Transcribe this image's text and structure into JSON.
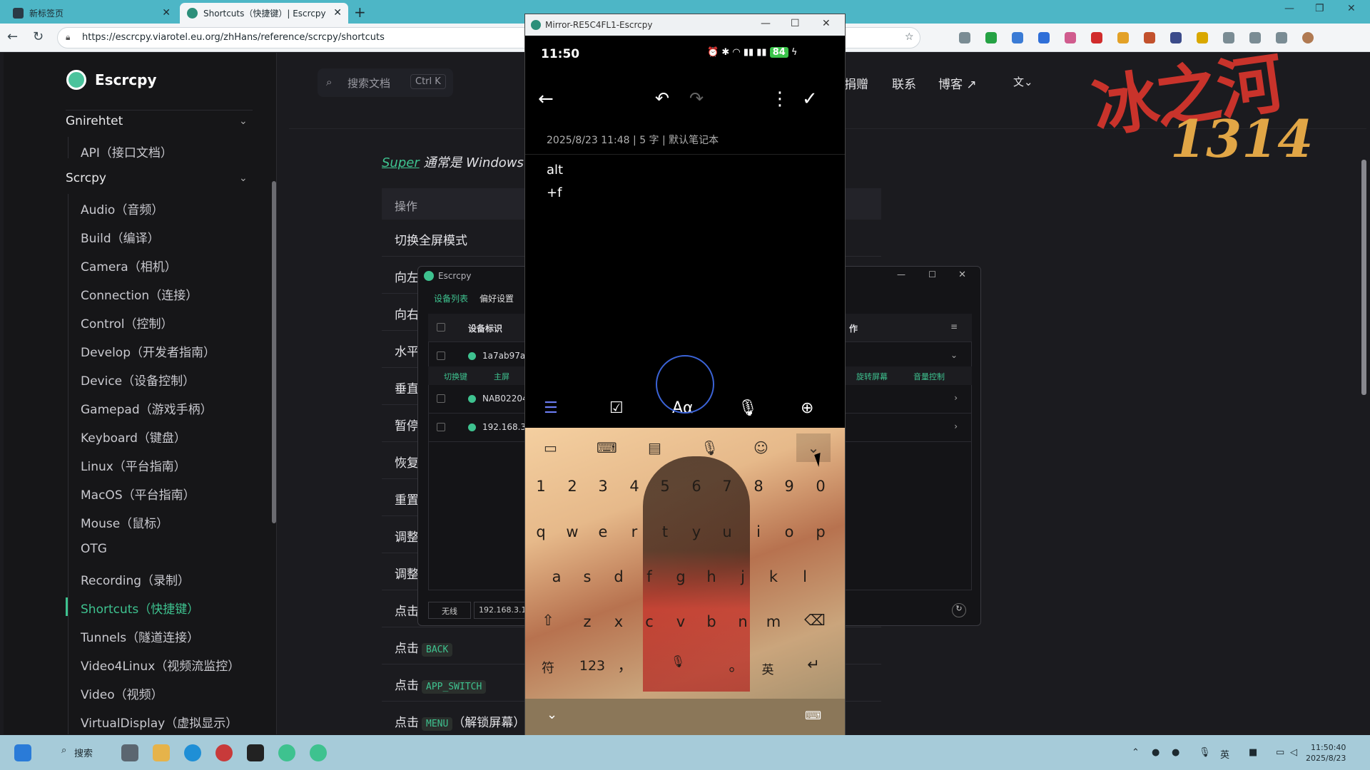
{
  "browser": {
    "tabs": [
      {
        "title": "新标签页"
      },
      {
        "title": "Shortcuts（快捷键）| Escrcpy"
      }
    ],
    "url": "https://escrcpy.viarotel.eu.org/zhHans/reference/scrcpy/shortcuts"
  },
  "site": {
    "brand": "Escrcpy",
    "search_placeholder": "搜索文档",
    "search_shortcut": "Ctrl K",
    "nav": [
      "捐赠",
      "联系",
      "博客 ↗"
    ],
    "sidebar": {
      "section1": "Gnirehtet",
      "section1_items": [
        "API（接口文档）"
      ],
      "section2": "Scrcpy",
      "section2_items": [
        "Audio（音频）",
        "Build（编译）",
        "Camera（相机）",
        "Connection（连接）",
        "Control（控制）",
        "Develop（开发者指南）",
        "Device（设备控制）",
        "Gamepad（游戏手柄）",
        "Keyboard（键盘）",
        "Linux（平台指南）",
        "MacOS（平台指南）",
        "Mouse（鼠标）",
        "OTG",
        "Recording（录制）",
        "Shortcuts（快捷键）",
        "Tunnels（隧道连接）",
        "Video4Linux（视频流监控）",
        "Video（视频）",
        "VirtualDisplay（虚拟显示）"
      ],
      "active": "Shortcuts（快捷键）"
    },
    "content": {
      "super_kw": "Super",
      "super_text": " 通常是 Windows",
      "table_header": "操作",
      "rows": [
        {
          "label": "切换全屏模式"
        },
        {
          "label": "向左"
        },
        {
          "label": "向右"
        },
        {
          "label": "水平"
        },
        {
          "label": "垂直"
        },
        {
          "label": "暂停"
        },
        {
          "label": "恢复"
        },
        {
          "label": "重置"
        },
        {
          "label": "调整"
        },
        {
          "label": "调整"
        },
        {
          "label": "点击"
        },
        {
          "label": "点击",
          "code": "BACK"
        },
        {
          "label": "点击",
          "code": "APP_SWITCH"
        },
        {
          "label": "点击",
          "code": "MENU",
          "suffix": "（解锁屏幕）"
        }
      ]
    }
  },
  "escrcpy_window": {
    "title": "Escrcpy",
    "tabs": [
      "设备列表",
      "偏好设置"
    ],
    "column_device": "设备标识",
    "column_ops": "作",
    "devices": [
      "1a7ab97a",
      "NAB02204",
      "192.168.3."
    ],
    "subbar": [
      "切换键",
      "主屏",
      "旋转屏幕",
      "音量控制"
    ],
    "footer_mode": "无线",
    "footer_ip": "192.168.3.1"
  },
  "mirror": {
    "window_title": "Mirror-RE5C4FL1-Escrcpy",
    "time": "11:50",
    "battery": "84",
    "note_meta": "2025/8/23 11:48  |  5 字  |  默认笔记本",
    "note_lines": [
      "alt",
      "+f"
    ],
    "format_bar": {
      "font_label": "Aα"
    },
    "keyboard": {
      "numbers": [
        "1",
        "2",
        "3",
        "4",
        "5",
        "6",
        "7",
        "8",
        "9",
        "0"
      ],
      "row1": [
        "q",
        "w",
        "e",
        "r",
        "t",
        "y",
        "u",
        "i",
        "o",
        "p"
      ],
      "row2": [
        "a",
        "s",
        "d",
        "f",
        "g",
        "h",
        "j",
        "k",
        "l"
      ],
      "row3": [
        "z",
        "x",
        "c",
        "v",
        "b",
        "n",
        "m"
      ],
      "sym": "符",
      "num": "123",
      "comma": "，",
      "period": "。",
      "lang": "英"
    }
  },
  "watermark": {
    "text": "冰之河",
    "number": "1314"
  },
  "taskbar": {
    "search": "搜索",
    "time": "11:50:40",
    "date": "2025/8/23"
  }
}
